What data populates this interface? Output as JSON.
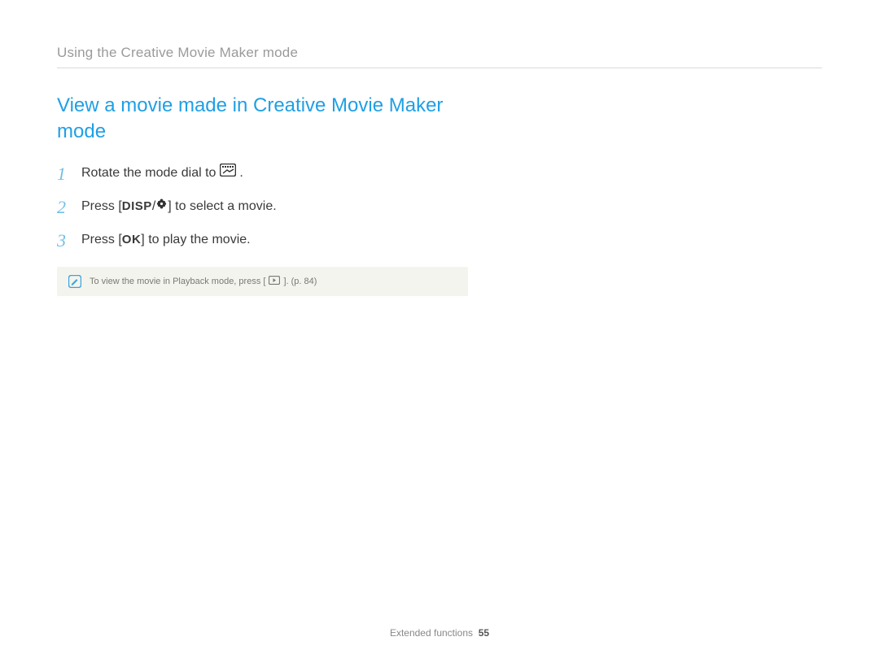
{
  "header": "Using the Creative Movie Maker mode",
  "title": "View a movie made in Creative Movie Maker mode",
  "steps": [
    {
      "num": "1",
      "pre": "Rotate the mode dial to ",
      "post": "."
    },
    {
      "num": "2",
      "pre": "Press [",
      "mid": "/",
      "post": "] to select a movie."
    },
    {
      "num": "3",
      "pre": "Press [",
      "post": "] to play the movie."
    }
  ],
  "note": {
    "pre": "To view the movie in Playback mode, press [",
    "post": "]. (p. 84)"
  },
  "footer": {
    "section": "Extended functions",
    "page": "55"
  },
  "icons": {
    "mode_dial": "movie-maker-mode-icon",
    "disp": "DISP",
    "macro": "macro-flower-icon",
    "ok": "OK",
    "play": "playback-icon",
    "note": "note-pencil-icon"
  }
}
